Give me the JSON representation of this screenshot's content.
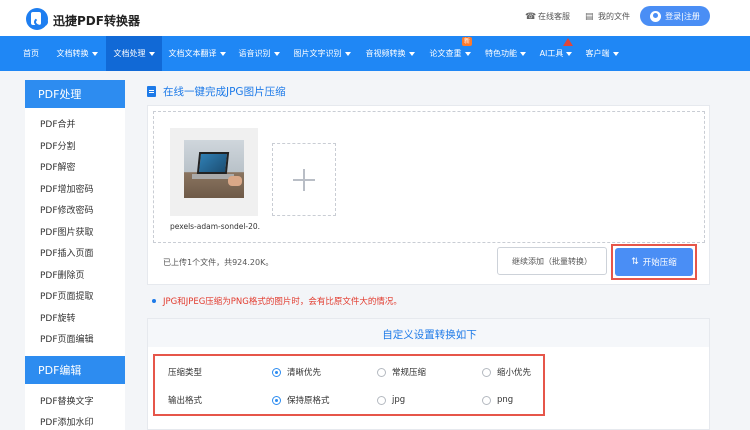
{
  "header": {
    "brand": "迅捷PDF转换器",
    "service_label": "在线客服",
    "files_label": "我的文件",
    "login_label": "登录|注册"
  },
  "nav": {
    "items": [
      {
        "label": "首页",
        "caret": false,
        "active": false
      },
      {
        "label": "文档转换",
        "caret": true,
        "active": false
      },
      {
        "label": "文档处理",
        "caret": true,
        "active": true
      },
      {
        "label": "文档文本翻译",
        "caret": true,
        "active": false
      },
      {
        "label": "语音识别",
        "caret": true,
        "active": false
      },
      {
        "label": "图片文字识别",
        "caret": true,
        "active": false
      },
      {
        "label": "音视频转换",
        "caret": true,
        "active": false
      },
      {
        "label": "论文查重",
        "caret": true,
        "active": false,
        "badge": "新"
      },
      {
        "label": "特色功能",
        "caret": true,
        "active": false
      },
      {
        "label": "AI工具",
        "caret": true,
        "active": false
      },
      {
        "label": "客户端",
        "caret": true,
        "active": false
      }
    ]
  },
  "sidebar": {
    "section1": "PDF处理",
    "items": [
      "PDF合并",
      "PDF分割",
      "PDF解密",
      "PDF增加密码",
      "PDF修改密码",
      "PDF图片获取",
      "PDF插入页面",
      "PDF删除页",
      "PDF页面提取",
      "PDF旋转",
      "PDF页面编辑"
    ],
    "section2": "PDF编辑",
    "items2": [
      "PDF替换文字",
      "PDF添加水印"
    ]
  },
  "main": {
    "title": "在线一键完成JPG图片压缩",
    "file_name": "pexels-adam-sondel-20...",
    "upload_status": "已上传1个文件，共924.20K。",
    "continue_button": "继续添加（批量转换）",
    "start_button": "开始压缩",
    "notice": "JPG和JPEG压缩为PNG格式的图片时，会有比原文件大的情况。"
  },
  "settings": {
    "title": "自定义设置转换如下",
    "compress_type_label": "压缩类型",
    "compress_options": [
      {
        "label": "清晰优先",
        "selected": true
      },
      {
        "label": "常规压缩",
        "selected": false
      },
      {
        "label": "缩小优先",
        "selected": false
      }
    ],
    "output_format_label": "输出格式",
    "format_options": [
      {
        "label": "保持原格式",
        "selected": true
      },
      {
        "label": "jpg",
        "selected": false
      },
      {
        "label": "png",
        "selected": false
      }
    ]
  },
  "colors": {
    "nav_bg": "#1f87f5",
    "nav_active": "#1169d6",
    "accent": "#1d7ae8",
    "button": "#4a8ef5",
    "highlight_border": "#e6564a",
    "notice": "#e23b2e"
  }
}
